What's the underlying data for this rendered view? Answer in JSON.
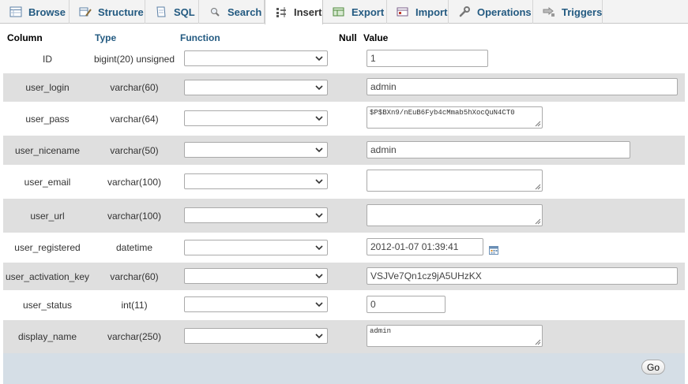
{
  "tabs": [
    {
      "label": "Browse",
      "icon": "browse-icon"
    },
    {
      "label": "Structure",
      "icon": "structure-icon"
    },
    {
      "label": "SQL",
      "icon": "sql-icon"
    },
    {
      "label": "Search",
      "icon": "search-icon"
    },
    {
      "label": "Insert",
      "icon": "insert-icon",
      "active": true
    },
    {
      "label": "Export",
      "icon": "export-icon"
    },
    {
      "label": "Import",
      "icon": "import-icon"
    },
    {
      "label": "Operations",
      "icon": "operations-icon"
    },
    {
      "label": "Triggers",
      "icon": "triggers-icon"
    }
  ],
  "header": {
    "column": "Column",
    "type": "Type",
    "function": "Function",
    "null": "Null",
    "value": "Value"
  },
  "rows": [
    {
      "name": "ID",
      "type": "bigint(20) unsigned",
      "function": "",
      "value": "1",
      "control": "input"
    },
    {
      "name": "user_login",
      "type": "varchar(60)",
      "function": "",
      "value": "admin",
      "control": "input"
    },
    {
      "name": "user_pass",
      "type": "varchar(64)",
      "function": "",
      "value": "$P$BXn9/nEuB6Fyb4cMmab5hXocQuN4CT0",
      "control": "textarea"
    },
    {
      "name": "user_nicename",
      "type": "varchar(50)",
      "function": "",
      "value": "admin",
      "control": "input"
    },
    {
      "name": "user_email",
      "type": "varchar(100)",
      "function": "",
      "value": "",
      "control": "textarea"
    },
    {
      "name": "user_url",
      "type": "varchar(100)",
      "function": "",
      "value": "",
      "control": "textarea"
    },
    {
      "name": "user_registered",
      "type": "datetime",
      "function": "",
      "value": "2012-01-07 01:39:41",
      "control": "input",
      "calendar_icon": "calendar-icon"
    },
    {
      "name": "user_activation_key",
      "type": "varchar(60)",
      "function": "",
      "value": "VSJVe7Qn1cz9jA5UHzKX",
      "control": "input"
    },
    {
      "name": "user_status",
      "type": "int(11)",
      "function": "",
      "value": "0",
      "control": "input"
    },
    {
      "name": "display_name",
      "type": "varchar(250)",
      "function": "",
      "value": "admin",
      "control": "textarea"
    }
  ],
  "footer": {
    "go_label": "Go"
  },
  "colors": {
    "tab_text": "#235a81",
    "row_alt": "#dfdfdf",
    "footer_bg": "#d5dee6"
  }
}
